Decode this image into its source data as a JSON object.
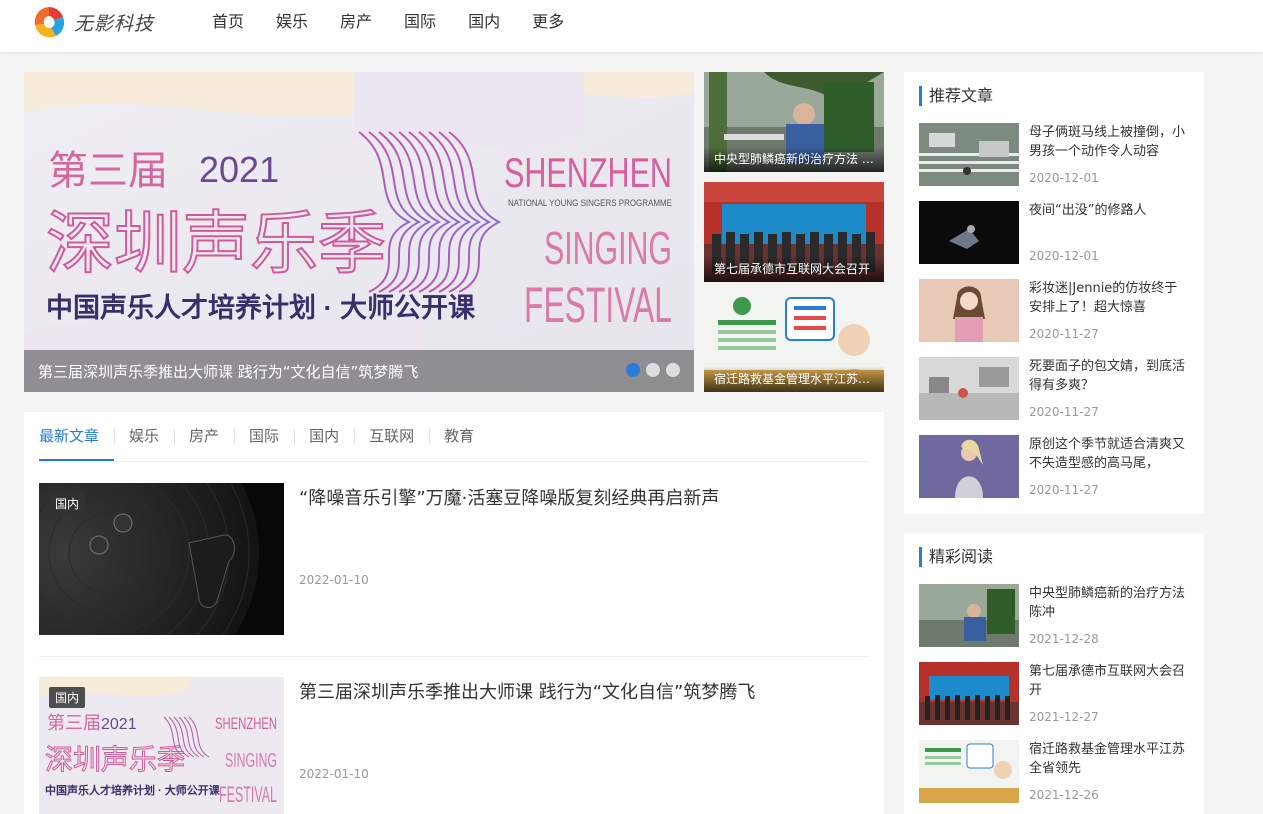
{
  "brand": {
    "name": "无影科技",
    "accent": "#2a7cdb"
  },
  "nav": [
    "首页",
    "娱乐",
    "房产",
    "国际",
    "国内",
    "更多"
  ],
  "slider": {
    "caption": "第三届深圳声乐季推出大师课 践行为“文化自信”筑梦腾飞",
    "banner": {
      "line1": "第三届",
      "year": "2021",
      "big": "深圳声乐季",
      "sub": "中国声乐人才培养计划 · 大师公开课",
      "en1": "SHENZHEN",
      "en_small": "NATIONAL YOUNG SINGERS PROGRAMME",
      "en2": "SINGING",
      "en3": "FESTIVAL"
    },
    "thumbs": [
      {
        "caption": "中央型肺鳞癌新的治疗方法 陈冲"
      },
      {
        "caption": "第七届承德市互联网大会召开"
      },
      {
        "caption": "宿迁路救基金管理水平江苏全省领先"
      }
    ]
  },
  "tabs": [
    "最新文章",
    "娱乐",
    "房产",
    "国际",
    "国内",
    "互联网",
    "教育"
  ],
  "articles": [
    {
      "tag": "国内",
      "title": "“降噪音乐引擎”万魔·活塞豆降噪版复刻经典再启新声",
      "date": "2022-01-10"
    },
    {
      "tag": "国内",
      "title": "第三届深圳声乐季推出大师课 践行为“文化自信”筑梦腾飞",
      "date": "2022-01-10"
    }
  ],
  "sidebar": {
    "recommended": {
      "title": "推荐文章",
      "items": [
        {
          "title": "母子俩斑马线上被撞倒，小男孩一个动作令人动容",
          "date": "2020-12-01"
        },
        {
          "title": "夜间“出没”的修路人",
          "date": "2020-12-01"
        },
        {
          "title": "彩妆迷|Jennie的仿妆终于安排上了！超大惊喜",
          "date": "2020-11-27"
        },
        {
          "title": "死要面子的包文婧，到底活得有多爽？",
          "date": "2020-11-27"
        },
        {
          "title": "原创这个季节就适合清爽又不失造型感的高马尾，",
          "date": "2020-11-27"
        }
      ]
    },
    "featured": {
      "title": "精彩阅读",
      "items": [
        {
          "title": "中央型肺鳞癌新的治疗方法 陈冲",
          "date": "2021-12-28"
        },
        {
          "title": "第七届承德市互联网大会召开",
          "date": "2021-12-27"
        },
        {
          "title": "宿迁路救基金管理水平江苏全省领先",
          "date": "2021-12-26"
        }
      ]
    }
  }
}
